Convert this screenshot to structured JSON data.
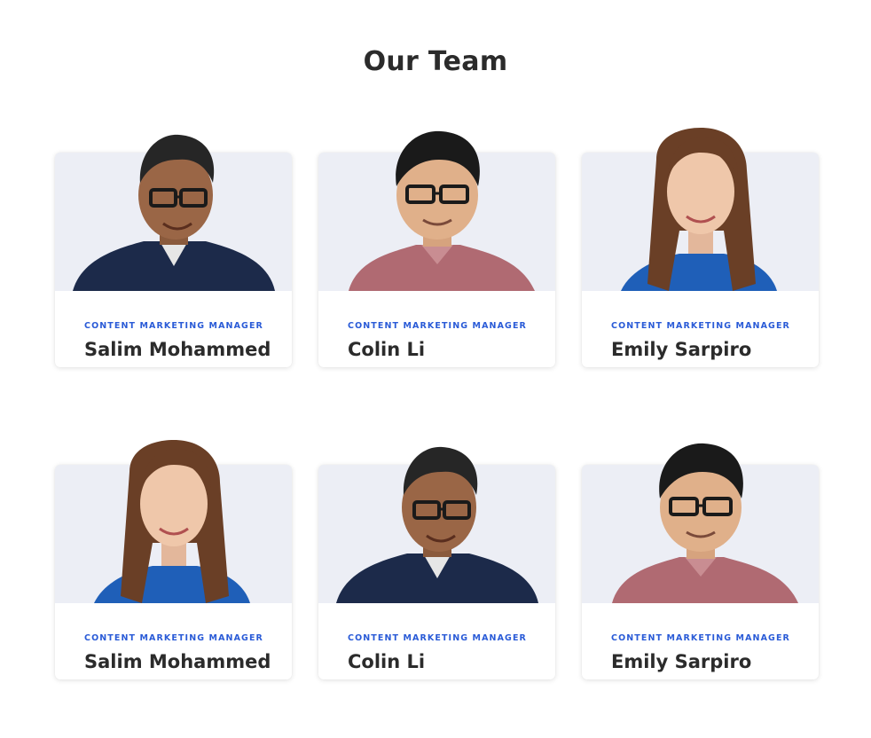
{
  "page": {
    "title": "Our Team"
  },
  "team": [
    {
      "role": "CONTENT MARKETING MANAGER",
      "name": "Salim Mohammed",
      "avatar": "man-glasses-navy"
    },
    {
      "role": "CONTENT MARKETING MANAGER",
      "name": "Colin Li",
      "avatar": "man-glasses-pink"
    },
    {
      "role": "CONTENT MARKETING MANAGER",
      "name": "Emily Sarpiro",
      "avatar": "woman-blue"
    },
    {
      "role": "CONTENT MARKETING MANAGER",
      "name": "Salim Mohammed",
      "avatar": "woman-blue"
    },
    {
      "role": "CONTENT MARKETING MANAGER",
      "name": "Colin Li",
      "avatar": "man-glasses-navy"
    },
    {
      "role": "CONTENT MARKETING MANAGER",
      "name": "Emily Sarpiro",
      "avatar": "man-glasses-pink"
    }
  ],
  "colors": {
    "accent": "#2a5bd7",
    "text": "#2b2b2b",
    "photo_bg": "#eceef5"
  }
}
